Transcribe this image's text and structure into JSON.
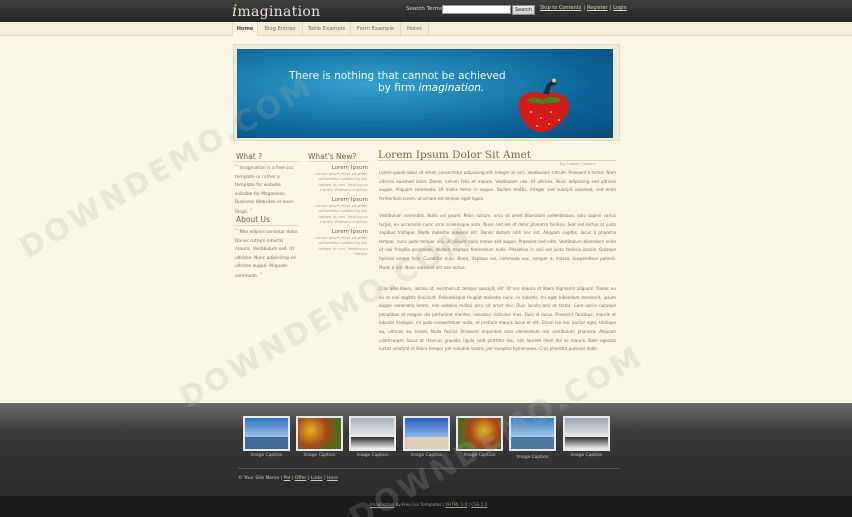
{
  "header": {
    "logo_first": "i",
    "logo_rest": "magination",
    "search_label": "Search Terms:",
    "search_value": "",
    "search_button": "Search",
    "links": [
      "Skip to Contents",
      "Register",
      "Login"
    ]
  },
  "nav": {
    "tabs": [
      "Home",
      "Blog Entries",
      "Table Example",
      "Form Example",
      "Notes"
    ],
    "active": "Home"
  },
  "banner": {
    "line1": "There is nothing that cannot be achieved",
    "line2_prefix": "by firm ",
    "line2_em": "imagination."
  },
  "sidebar": {
    "what_title": "What ?",
    "what_text": "Imagination is a free css template or rather a template for website suitable for Magazines, Business Websites or even Blogs.",
    "about_title": "About Us",
    "about_text": "Non ellipsis consetur dolor. Donec rutrum lobortis mauris. Vestibulum sed. Ut ultrices. Nunc adipiscing ed ultrices augue. Aliquam commodo.",
    "news_title": "What's New?",
    "news": [
      {
        "title": "Lorem Ipsum",
        "text": "Lorem ipsum dolor sit amet, consectetur adipiscing elit. Integer ac orci. Vestibulum rutrum. Praesent a lectus."
      },
      {
        "title": "Lorem Ipsum",
        "text": "Lorem ipsum dolor sit amet, consectetur adipiscing elit. Integer ac orci. Vestibulum rutrum. Praesent a lectus."
      },
      {
        "title": "Lorem Ipsum",
        "text": "Lorem ipsum dolor sit amet, consectetur adipiscing elit. Integer ac orci. Vestibulum rutrum."
      }
    ]
  },
  "article": {
    "title": "Lorem Ipsum Dolor Sit Amet",
    "byline": "By: Lorem | Ipsum",
    "paragraphs": [
      "Lorem ipsum dolor sit amet, consectetur adipiscing elit. Integer ac orci. Vestibulum rutrum. Praesent a lectus. Nam ultrices euismod dolor. Donec rutrum felis et mauris. Vestibulum nisi. Ut ultrices. Nunc adipiscing sed ultrices augue. Aliquam commodo. Ut mollis tortor in augue. Nullam mattis. Integer sed suscipit euismod, sed enim fermentum lorem, ut ornare est tempor eget ligula.",
      "Vestibulum venenatis. Nulla vel ipsum. Proin rutrum, urna sit amet bibendum pellentesque, odio sapien varius turpis, eu accumsan nunc urna scelerisque ante. Nunc sed leo et dolor pharetra facilisis. Sed sed lectus at justo dapibus tristique. Morbi molestie pulvinar elit. Donec dictum nibh nec est. Aliquam sagittis, lacus a pharetra tempor, nunc justo tempor nisi, ut aliquet nulla metus sed augue. Praesent sed nibh. Vestibulum bibendum enim ut nisi fringilla accumsan. Nullam dapibus fermentum nulla. Phasellus in orci vel justo facilisis iaculis. Quisque facilisis ornare felis. Curabitur nunc libero, dapibus vel, commodo nec, semper a, massa. Suspendisse potenti. Morbi a nisl. Nunc euismod elit non lectus.",
      "Cras odio libero, lacinia at, euismod ut, tempor suscipit, elit. Ut nec mauris et libero dignissim aliquam. Donec eu ex et nisl sagittis tincidunt. Pellentesque feugiat molestie nunc. In lobortis, mi eget bibendum hendrerit, ipsum augue venenatis lorem, nec sodales metus arcu sit amet nisl. Duis iaculis orci et tortor. Cum sociis natoque penatibus et magnis dis parturient montes, nascetur ridiculus mus. Duis id lacus. Praesent faucibus, mauris et lobortis tristique, mi justo consectetuer nulla, et pretium mauris lacus et elit. Etiam leo leo, auctor eget, tristique eu, ultrices eu, lorem. Nulla facilisi. Praesent imperdiet ante elementum nisi vestibulum pharetra. Aliquam ullamcorper, lacus ut rhoncus gravida, ligula velit porttitor nisi, non laoreet diam dui ac mauris. Nam egestas luctus volutpat id libero tempor per conubia nostra, per inceptos hymenaeos. Cras pharetra pulvinar dolor."
    ]
  },
  "gallery": {
    "captions": [
      "Image Caption",
      "Image Caption",
      "Image Caption",
      "Image Caption",
      "Image Caption",
      "Image Caption",
      "Image Caption"
    ]
  },
  "footer": {
    "copyright": "© Your Site Name",
    "links": [
      "Pol",
      "Offer",
      "Links",
      "Here"
    ],
    "credit_link": "Imagination",
    "credit_mid": " by Free Css Templates | ",
    "credit_links": [
      "XHTML 1.0",
      "CSS 2.0"
    ]
  },
  "watermark": "DOWNDEMO.COM",
  "colors": {
    "background": "#faf6e6",
    "topbar": "#2f2f2f",
    "heading": "#7e6a2e",
    "banner_blue": "#0b5f95"
  }
}
